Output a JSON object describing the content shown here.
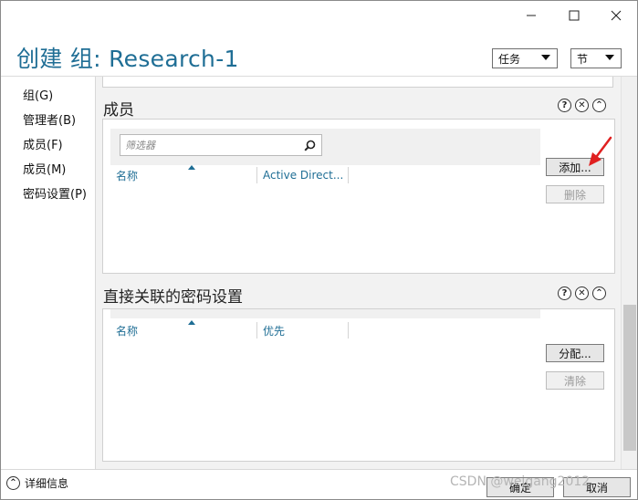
{
  "header": {
    "title": "创建 组: Research-1",
    "tasks_dropdown": "任务",
    "section_dropdown": "节"
  },
  "nav": {
    "items": [
      {
        "label": "组(G)"
      },
      {
        "label": "管理者(B)"
      },
      {
        "label": "成员(F)"
      },
      {
        "label": "成员(M)"
      },
      {
        "label": "密码设置(P)"
      }
    ]
  },
  "members_section": {
    "title": "成员",
    "filter_placeholder": "筛选器",
    "columns": [
      "名称",
      "Active Direct..."
    ],
    "add_button": "添加...",
    "remove_button": "删除"
  },
  "password_section": {
    "title": "直接关联的密码设置",
    "columns": [
      "名称",
      "优先"
    ],
    "assign_button": "分配...",
    "clear_button": "清除"
  },
  "section_icons": {
    "help": "?",
    "close": "✕",
    "collapse": "⌃"
  },
  "footer": {
    "details_label": "详细信息",
    "ok_button": "确定",
    "cancel_button": "取消"
  },
  "watermark": "CSDN @weigang2012"
}
